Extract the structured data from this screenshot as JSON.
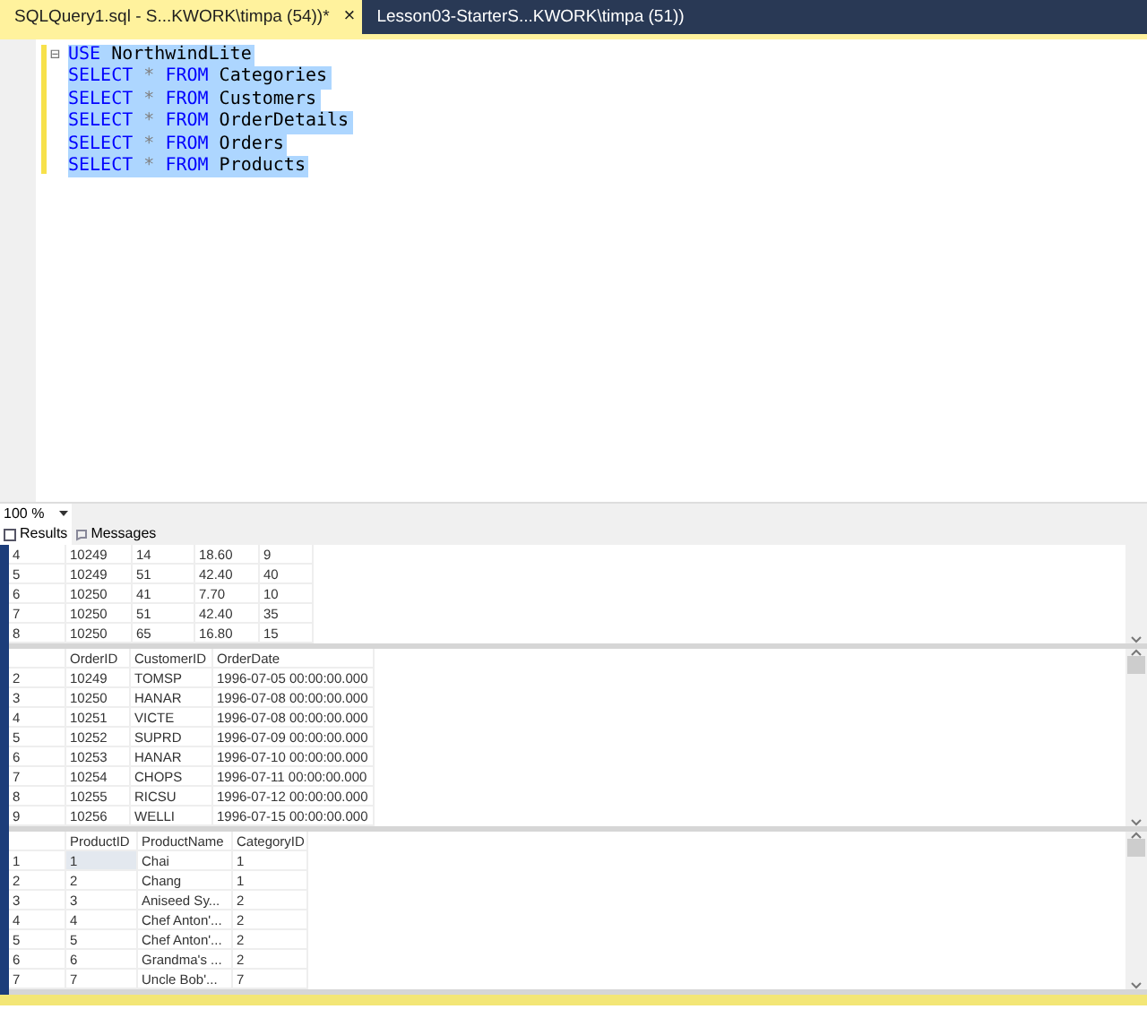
{
  "tabs": [
    {
      "label": "SQLQuery1.sql - S...KWORK\\timpa (54))*",
      "selected": true,
      "close": "×"
    },
    {
      "label": "Lesson03-StarterS...KWORK\\timpa (51))",
      "selected": false
    }
  ],
  "editor": {
    "fold": "⊟",
    "lines": [
      {
        "selected": true,
        "tokens": [
          {
            "kind": "keyword",
            "text": "USE"
          },
          {
            "kind": "plain",
            "text": " NorthwindLite"
          }
        ]
      },
      {
        "selected": true,
        "tokens": [
          {
            "kind": "keyword",
            "text": "SELECT"
          },
          {
            "kind": "operator",
            "text": " * "
          },
          {
            "kind": "keyword",
            "text": "FROM"
          },
          {
            "kind": "plain",
            "text": " Categories"
          }
        ]
      },
      {
        "selected": true,
        "tokens": [
          {
            "kind": "keyword",
            "text": "SELECT"
          },
          {
            "kind": "operator",
            "text": " * "
          },
          {
            "kind": "keyword",
            "text": "FROM"
          },
          {
            "kind": "plain",
            "text": " Customers"
          }
        ]
      },
      {
        "selected": true,
        "tokens": [
          {
            "kind": "keyword",
            "text": "SELECT"
          },
          {
            "kind": "operator",
            "text": " * "
          },
          {
            "kind": "keyword",
            "text": "FROM"
          },
          {
            "kind": "plain",
            "text": " OrderDetails"
          }
        ]
      },
      {
        "selected": true,
        "tokens": [
          {
            "kind": "keyword",
            "text": "SELECT"
          },
          {
            "kind": "operator",
            "text": " * "
          },
          {
            "kind": "keyword",
            "text": "FROM"
          },
          {
            "kind": "plain",
            "text": " Orders"
          }
        ]
      },
      {
        "selected": true,
        "tokens": [
          {
            "kind": "keyword",
            "text": "SELECT"
          },
          {
            "kind": "operator",
            "text": " * "
          },
          {
            "kind": "keyword",
            "text": "FROM"
          },
          {
            "kind": "plain",
            "text": " Products"
          }
        ]
      }
    ]
  },
  "zoom": {
    "value": "100 %"
  },
  "result_tabs": [
    {
      "label": "Results",
      "selected": true
    },
    {
      "label": "Messages",
      "selected": false
    }
  ],
  "grids": [
    {
      "rows": [
        {
          "number": "4",
          "selected": false,
          "cells": [
            "10249",
            "14",
            "18.60",
            "9"
          ]
        },
        {
          "number": "5",
          "selected": false,
          "cells": [
            "10249",
            "51",
            "42.40",
            "40"
          ]
        },
        {
          "number": "6",
          "selected": false,
          "cells": [
            "10250",
            "41",
            "7.70",
            "10"
          ]
        },
        {
          "number": "7",
          "selected": false,
          "cells": [
            "10250",
            "51",
            "42.40",
            "35"
          ]
        },
        {
          "number": "8",
          "selected": false,
          "cells": [
            "10250",
            "65",
            "16.80",
            "15"
          ]
        }
      ]
    },
    {
      "columns": [
        "OrderID",
        "CustomerID",
        "OrderDate"
      ],
      "rows": [
        {
          "number": "2",
          "selected": false,
          "cells": [
            "10249",
            "TOMSP",
            "1996-07-05 00:00:00.000"
          ]
        },
        {
          "number": "3",
          "selected": false,
          "cells": [
            "10250",
            "HANAR",
            "1996-07-08 00:00:00.000"
          ]
        },
        {
          "number": "4",
          "selected": false,
          "cells": [
            "10251",
            "VICTE",
            "1996-07-08 00:00:00.000"
          ]
        },
        {
          "number": "5",
          "selected": false,
          "cells": [
            "10252",
            "SUPRD",
            "1996-07-09 00:00:00.000"
          ]
        },
        {
          "number": "6",
          "selected": false,
          "cells": [
            "10253",
            "HANAR",
            "1996-07-10 00:00:00.000"
          ]
        },
        {
          "number": "7",
          "selected": false,
          "cells": [
            "10254",
            "CHOPS",
            "1996-07-11 00:00:00.000"
          ]
        },
        {
          "number": "8",
          "selected": false,
          "cells": [
            "10255",
            "RICSU",
            "1996-07-12 00:00:00.000"
          ]
        },
        {
          "number": "9",
          "selected": false,
          "cells": [
            "10256",
            "WELLI",
            "1996-07-15 00:00:00.000"
          ]
        }
      ]
    },
    {
      "columns": [
        "ProductID",
        "ProductName",
        "CategoryID"
      ],
      "rows": [
        {
          "number": "1",
          "selected": true,
          "cells": [
            "1",
            "Chai",
            "1"
          ]
        },
        {
          "number": "2",
          "selected": false,
          "cells": [
            "2",
            "Chang",
            "1"
          ]
        },
        {
          "number": "3",
          "selected": false,
          "cells": [
            "3",
            "Aniseed Sy...",
            "2"
          ]
        },
        {
          "number": "4",
          "selected": false,
          "cells": [
            "4",
            "Chef Anton'...",
            "2"
          ]
        },
        {
          "number": "5",
          "selected": false,
          "cells": [
            "5",
            "Chef Anton'...",
            "2"
          ]
        },
        {
          "number": "6",
          "selected": false,
          "cells": [
            "6",
            "Grandma's ...",
            "2"
          ]
        },
        {
          "number": "7",
          "selected": false,
          "cells": [
            "7",
            "Uncle Bob'...",
            "7"
          ]
        }
      ]
    }
  ]
}
